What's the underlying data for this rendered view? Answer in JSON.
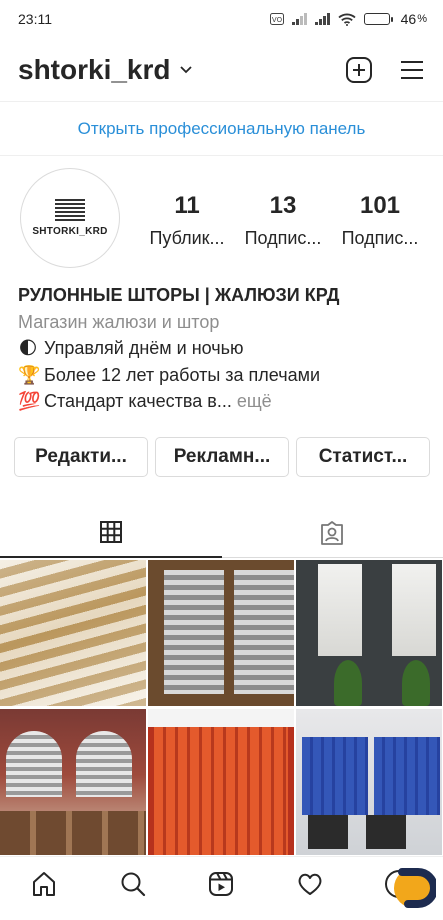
{
  "status_bar": {
    "time": "23:11",
    "battery": "46",
    "battery_level": 0.46,
    "icons": [
      "volte-icon",
      "signal-icon",
      "signal-icon",
      "wifi-icon",
      "battery-icon"
    ]
  },
  "header": {
    "username": "shtorki_krd",
    "icons": [
      "chevron-down-icon",
      "plus-square-icon",
      "menu-icon"
    ]
  },
  "pro_dashboard": {
    "label": "Открыть профессиональную панель"
  },
  "profile": {
    "avatar_text": "SHTORKI_KRD",
    "stats": [
      {
        "value": "11",
        "label": "Публик..."
      },
      {
        "value": "13",
        "label": "Подпис..."
      },
      {
        "value": "101",
        "label": "Подпис..."
      }
    ]
  },
  "bio": {
    "name": "РУЛОННЫЕ ШТОРЫ | ЖАЛЮЗИ КРД",
    "category": "Магазин жалюзи и штор",
    "lines": [
      {
        "emoji": "🌓",
        "text": "Управляй днём и ночью"
      },
      {
        "emoji": "🏆",
        "text": "Более 12 лет работы за плечами"
      },
      {
        "emoji": "💯",
        "text": "Стандарт качества в..."
      }
    ],
    "more": "ещё"
  },
  "buttons": [
    {
      "label": "Редакти..."
    },
    {
      "label": "Рекламн..."
    },
    {
      "label": "Статист..."
    }
  ],
  "tabs": [
    {
      "icon": "grid-icon",
      "active": true
    },
    {
      "icon": "tagged-person-icon",
      "active": false
    }
  ],
  "posts": [
    {
      "subject": "beige zebra roller blinds on window"
    },
    {
      "subject": "grey day-night blinds in wooden frame"
    },
    {
      "subject": "white roller shades on dark windows"
    },
    {
      "subject": "classroom with arched windows and blinds"
    },
    {
      "subject": "orange vertical blinds"
    },
    {
      "subject": "blue vertical blinds in office"
    }
  ],
  "bottom_nav": {
    "items": [
      "home-icon",
      "search-icon",
      "reels-icon",
      "heart-icon",
      "profile-avatar"
    ]
  },
  "colors": {
    "link_blue": "#2a8fd8",
    "text": "#262626",
    "muted": "#8e8e8e",
    "border": "#dbdbdb"
  }
}
